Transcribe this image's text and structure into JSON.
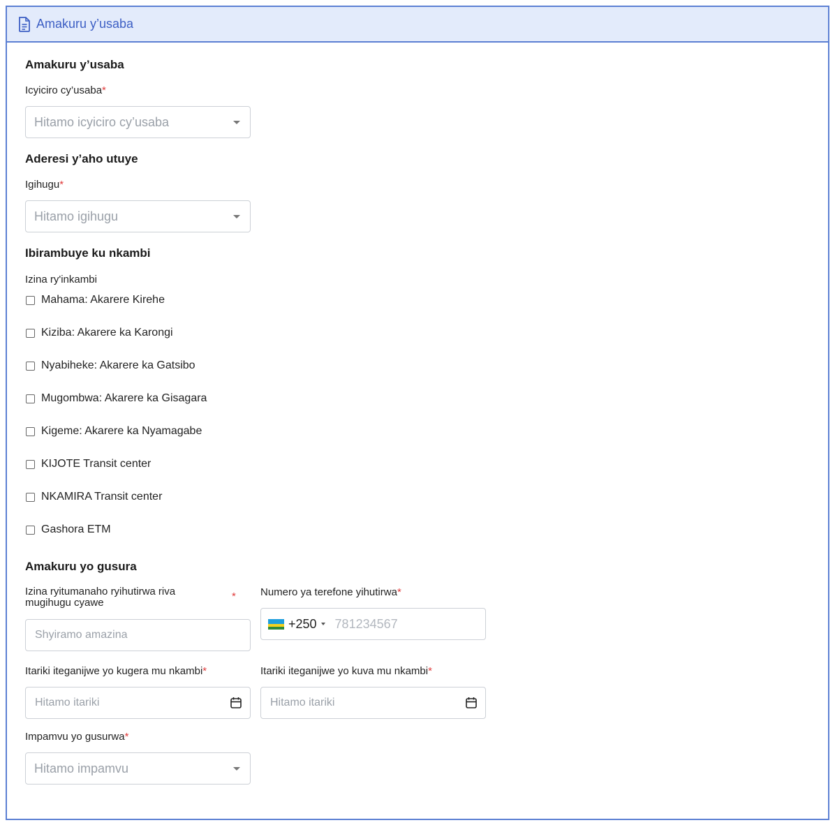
{
  "header": {
    "title": "Amakuru y’usaba",
    "icon": "document-icon"
  },
  "section1": {
    "title": "Amakuru y’usaba",
    "category_label": "Icyiciro cy’usaba",
    "category_placeholder": "Hitamo icyiciro cy’usaba"
  },
  "section2": {
    "title": "Aderesi y’aho utuye",
    "country_label": "Igihugu",
    "country_placeholder": "Hitamo igihugu"
  },
  "section3": {
    "title": "Ibirambuye ku nkambi",
    "camp_label": "Izina ry'inkambi",
    "camps": [
      "Mahama: Akarere Kirehe",
      "Kiziba: Akarere ka Karongi",
      "Nyabiheke: Akarere ka Gatsibo",
      "Mugombwa: Akarere ka Gisagara",
      "Kigeme: Akarere ka Nyamagabe",
      "KIJOTE Transit center",
      "NKAMIRA Transit center",
      "Gashora ETM"
    ]
  },
  "section4": {
    "title": "Amakuru yo gusura",
    "host_name_label_line1": "Izina ryitumanaho ryihutirwa riva",
    "host_name_label_line2": "mugihugu cyawe",
    "host_name_placeholder": "Shyiramo amazina",
    "phone_label": "Numero ya terefone yihutirwa",
    "phone_code": "+250",
    "phone_placeholder": "781234567",
    "arrival_label": "Itariki iteganijwe yo kugera mu nkambi",
    "arrival_placeholder": "Hitamo itariki",
    "departure_label": "Itariki iteganijwe yo kuva mu nkambi",
    "departure_placeholder": "Hitamo itariki",
    "reason_label": "Impamvu yo gusurwa",
    "reason_placeholder": "Hitamo impamvu"
  },
  "required_marker": "*",
  "colors": {
    "accent": "#3d5fc4",
    "header_bg": "#e3ebfb",
    "border": "#5b7fd3",
    "required": "#e03b3b"
  }
}
